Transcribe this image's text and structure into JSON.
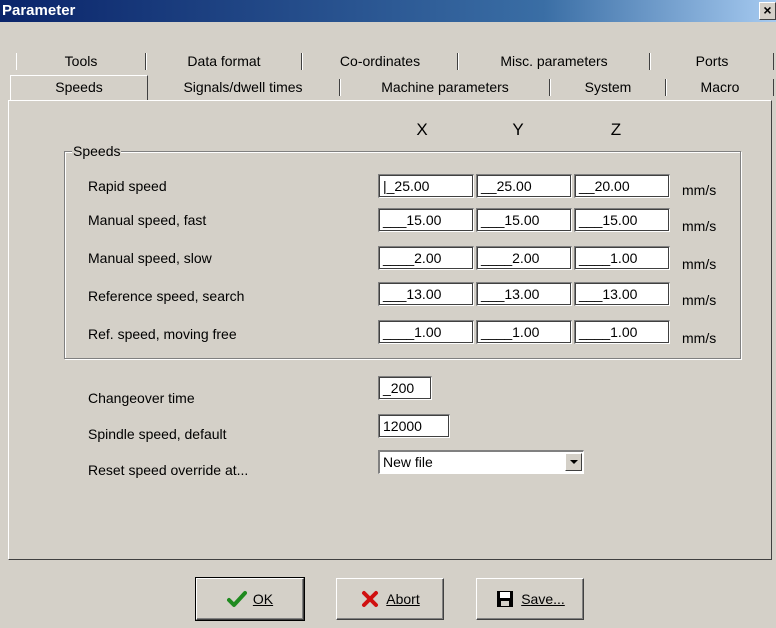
{
  "window": {
    "title": "Parameter",
    "close_glyph": "×"
  },
  "tabs_row1": [
    "Tools",
    "Data format",
    "Co-ordinates",
    "Misc. parameters",
    "Ports"
  ],
  "tabs_row2": [
    "Speeds",
    "Signals/dwell times",
    "Machine parameters",
    "System",
    "Macro"
  ],
  "active_tab": "Speeds",
  "columns": [
    "X",
    "Y",
    "Z"
  ],
  "speeds_group": {
    "title": "Speeds",
    "rows": [
      {
        "label": "Rapid speed",
        "x": "|_25.00",
        "y": "__25.00",
        "z": "__20.00",
        "unit": "mm/s"
      },
      {
        "label": "Manual speed, fast",
        "x": "___15.00",
        "y": "___15.00",
        "z": "___15.00",
        "unit": "mm/s"
      },
      {
        "label": "Manual speed, slow",
        "x": "____2.00",
        "y": "____2.00",
        "z": "____1.00",
        "unit": "mm/s"
      },
      {
        "label": "Reference speed, search",
        "x": "___13.00",
        "y": "___13.00",
        "z": "___13.00",
        "unit": "mm/s"
      },
      {
        "label": "Ref. speed, moving free",
        "x": "____1.00",
        "y": "____1.00",
        "z": "____1.00",
        "unit": "mm/s"
      }
    ]
  },
  "other": {
    "changeover_label": "Changeover time",
    "changeover_value": "_200",
    "spindle_label": "Spindle speed, default",
    "spindle_value": "12000",
    "reset_label": "Reset speed override at...",
    "reset_value": "New file"
  },
  "buttons": {
    "ok_label": "OK",
    "abort_label": "Abort",
    "save_label": "Save..."
  },
  "icons": {
    "ok": "checkmark-icon",
    "abort": "x-icon",
    "save": "floppy-disk-icon"
  },
  "colors": {
    "title_start": "#0a246a",
    "title_end": "#a6caf0",
    "ok_green": "#1f8a1f",
    "abort_red": "#d01010",
    "dialog_bg": "#d4d0c8"
  }
}
